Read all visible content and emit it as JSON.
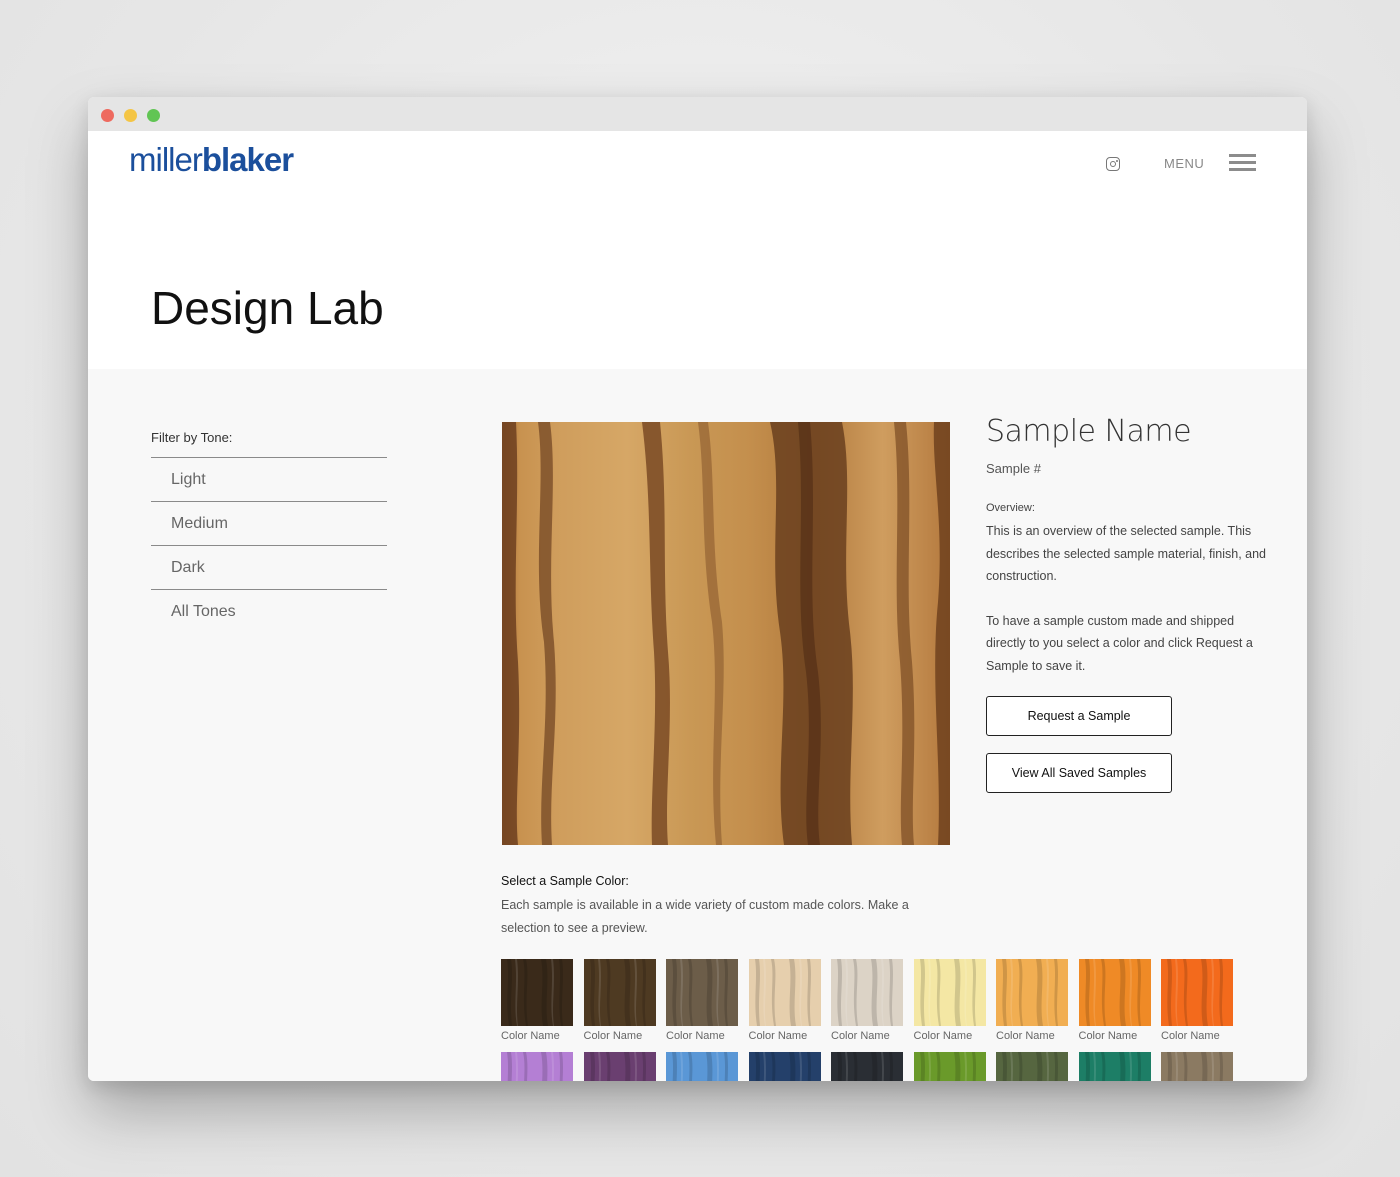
{
  "window": {
    "controls": [
      "close",
      "minimize",
      "zoom"
    ]
  },
  "header": {
    "logo_part1": "miller",
    "logo_part2": "blaker",
    "brand_color": "#1b4f9c",
    "instagram_icon": "instagram-icon",
    "menu_label": "MENU",
    "menu_icon": "hamburger-icon"
  },
  "page": {
    "title": "Design Lab"
  },
  "filter": {
    "label": "Filter by Tone:",
    "items": [
      "Light",
      "Medium",
      "Dark",
      "All Tones"
    ]
  },
  "sample": {
    "name": "Sample Name",
    "number": "Sample #",
    "overview_label": "Overview:",
    "overview_text": "This is an overview of the selected sample. This describes the selected sample material, finish, and construction.",
    "request_text": "To have a sample custom made and shipped directly to you select a color and click Request a Sample to save it.",
    "request_button": "Request a Sample",
    "view_saved_button": "View All Saved Samples"
  },
  "colors": {
    "label": "Select a Sample Color:",
    "description": "Each sample is available in a wide variety of custom made colors. Make a selection to see a preview.",
    "row1": [
      {
        "name": "Color Name",
        "color": "#3a2a1a"
      },
      {
        "name": "Color Name",
        "color": "#4e3a22"
      },
      {
        "name": "Color Name",
        "color": "#6c5d49"
      },
      {
        "name": "Color Name",
        "color": "#e6cfad"
      },
      {
        "name": "Color Name",
        "color": "#dcd3c6"
      },
      {
        "name": "Color Name",
        "color": "#f4e7a4"
      },
      {
        "name": "Color Name",
        "color": "#f1ae52"
      },
      {
        "name": "Color Name",
        "color": "#ef8a26"
      },
      {
        "name": "Color Name",
        "color": "#f36a1c"
      }
    ],
    "row2": [
      {
        "color": "#b47fd4"
      },
      {
        "color": "#6a3f70"
      },
      {
        "color": "#5a97d6"
      },
      {
        "color": "#24406a"
      },
      {
        "color": "#2a2e34"
      },
      {
        "color": "#6a9a2a"
      },
      {
        "color": "#566640"
      },
      {
        "color": "#1d7e66"
      },
      {
        "color": "#8b7a62"
      }
    ]
  }
}
